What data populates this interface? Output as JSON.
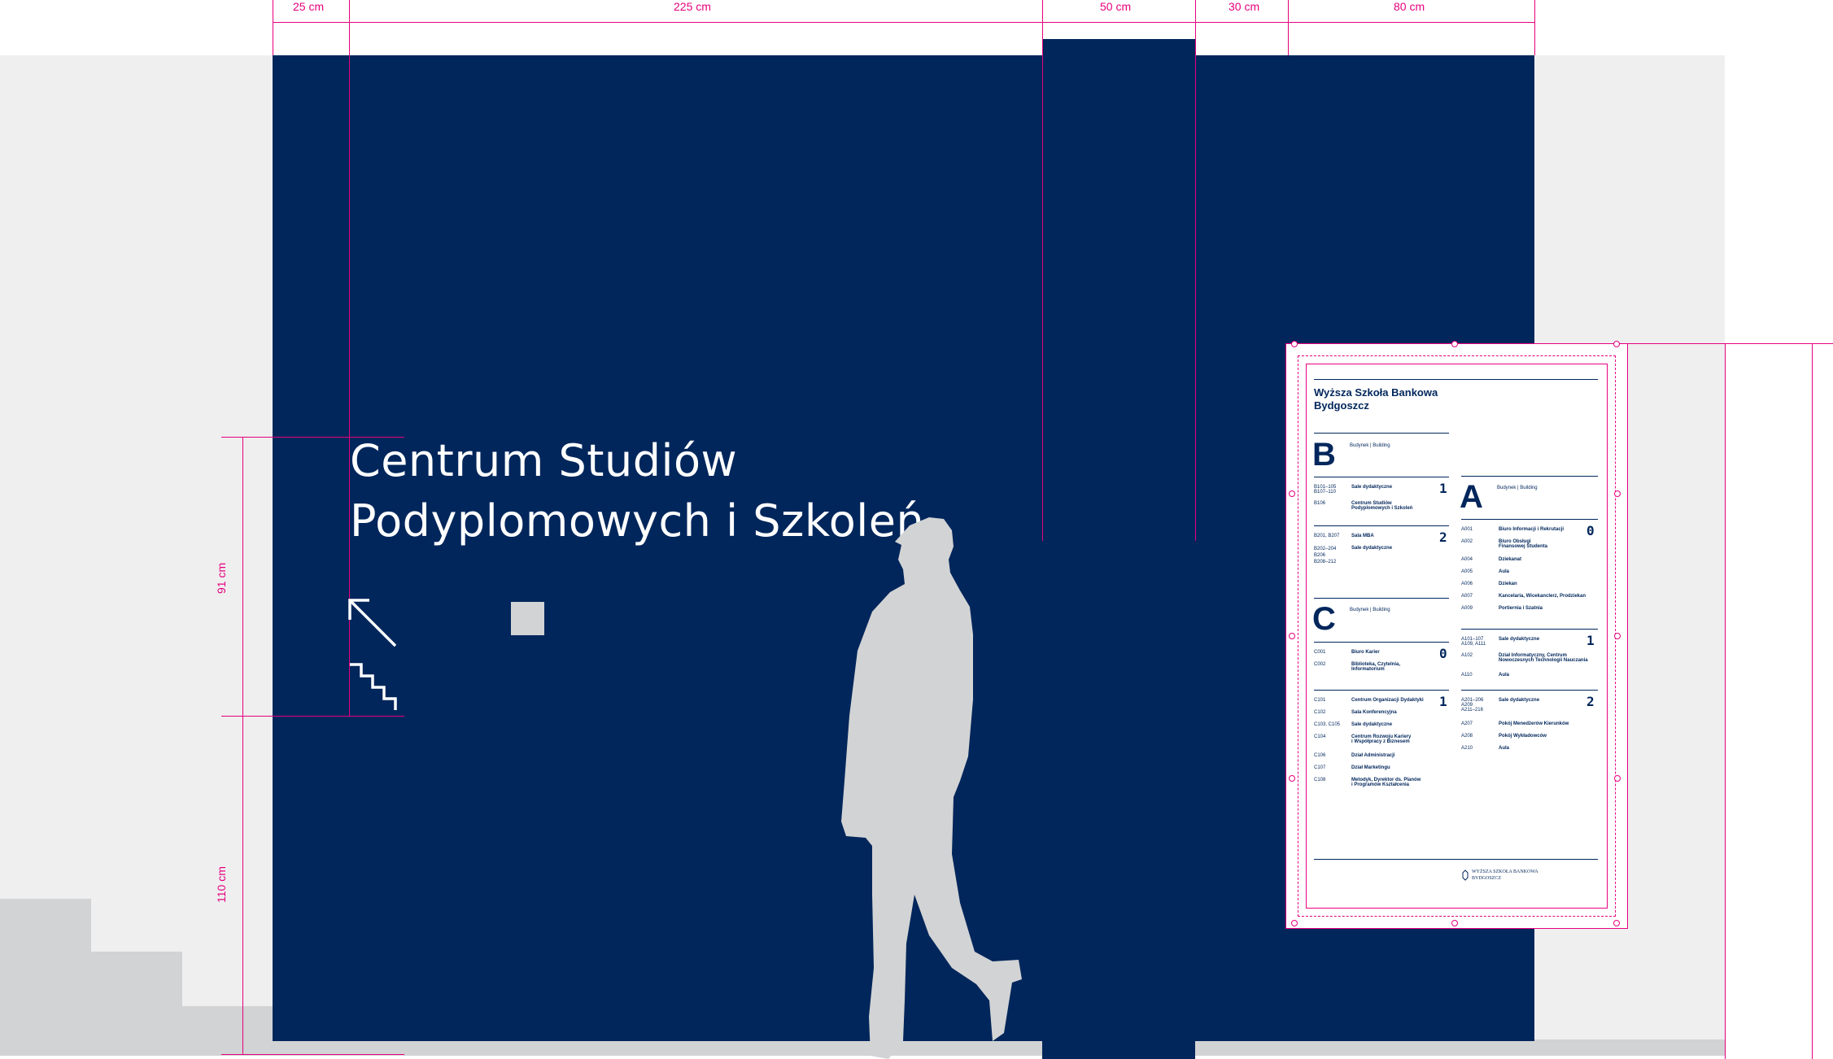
{
  "dimensions": {
    "top": [
      "25 cm",
      "225 cm",
      "50 cm",
      "30 cm",
      "80 cm"
    ],
    "left": [
      "91 cm",
      "110 cm"
    ]
  },
  "sign": {
    "title_line1": "Centrum Studiów",
    "title_line2": "Podyplomowych i Szkoleń"
  },
  "icons": [
    "arrow-up-left-icon",
    "stairs-icon",
    "square-icon"
  ],
  "colors": {
    "navy": "#00265b",
    "magenta": "#e6007e",
    "silhouette": "#d2d3d4",
    "wall": "#efefef"
  },
  "board": {
    "title_line1": "Wyższa Szkoła Bankowa",
    "title_line2": "Bydgoszcz",
    "building_label": "Budynek | Building",
    "footer_logo_line1": "WYŻSZA SZKOŁA BANKOWA",
    "footer_logo_line2": "BYDGOSZCZ",
    "buildings": {
      "B": {
        "letter": "B",
        "floors": [
          {
            "num": "1",
            "rooms": [
              {
                "code": "B101–105\nB107–110",
                "name": "Sale dydaktyczne"
              },
              {
                "code": "B106",
                "name": "Centrum Studiów\nPodyplomowych i Szkoleń"
              }
            ]
          },
          {
            "num": "2",
            "rooms": [
              {
                "code": "B201, B207",
                "name": "Sala MBA"
              },
              {
                "code": "B202–204\nB206\nB208–212",
                "name": "Sale dydaktyczne"
              }
            ]
          }
        ]
      },
      "C": {
        "letter": "C",
        "floors": [
          {
            "num": "0",
            "rooms": [
              {
                "code": "C001",
                "name": "Biuro Karier"
              },
              {
                "code": "C002",
                "name": "Biblioteka, Czytelnia,\nInformatorium"
              }
            ]
          },
          {
            "num": "1",
            "rooms": [
              {
                "code": "C101",
                "name": "Centrum Organizacji Dydaktyki"
              },
              {
                "code": "C102",
                "name": "Sala Konferencyjna"
              },
              {
                "code": "C103, C105",
                "name": "Sale dydaktyczne"
              },
              {
                "code": "C104",
                "name": "Centrum Rozwoju Kariery\ni Współpracy z Biznesem"
              },
              {
                "code": "C106",
                "name": "Dział Administracji"
              },
              {
                "code": "C107",
                "name": "Dział Marketingu"
              },
              {
                "code": "C108",
                "name": "Metodyk, Dyrektor ds. Planów\ni Programów Kształcenia"
              }
            ]
          }
        ]
      },
      "A": {
        "letter": "A",
        "floors": [
          {
            "num": "0",
            "rooms": [
              {
                "code": "A001",
                "name": "Biuro Informacji i Rekrutacji"
              },
              {
                "code": "A002",
                "name": "Biuro Obsługi\nFinansowej Studenta"
              },
              {
                "code": "A004",
                "name": "Dziekanat"
              },
              {
                "code": "A005",
                "name": "Aula"
              },
              {
                "code": "A006",
                "name": "Dziekan"
              },
              {
                "code": "A007",
                "name": "Kancelaria, Wicekanclerz, Prodziekan"
              },
              {
                "code": "A009",
                "name": "Portiernia i Szatnia"
              }
            ]
          },
          {
            "num": "1",
            "rooms": [
              {
                "code": "A101–107\nA109, A111",
                "name": "Sale dydaktyczne"
              },
              {
                "code": "A102",
                "name": "Dział Informatyczny, Centrum\nNowoczesnych Technologii Nauczania"
              },
              {
                "code": "A110",
                "name": "Aula"
              }
            ]
          },
          {
            "num": "2",
            "rooms": [
              {
                "code": "A201–206\nA209\nA211–216",
                "name": "Sale dydaktyczne"
              },
              {
                "code": "A207",
                "name": "Pokój Menedżerów Kierunków"
              },
              {
                "code": "A208",
                "name": "Pokój Wykładowców"
              },
              {
                "code": "A210",
                "name": "Aula"
              }
            ]
          }
        ]
      }
    }
  }
}
